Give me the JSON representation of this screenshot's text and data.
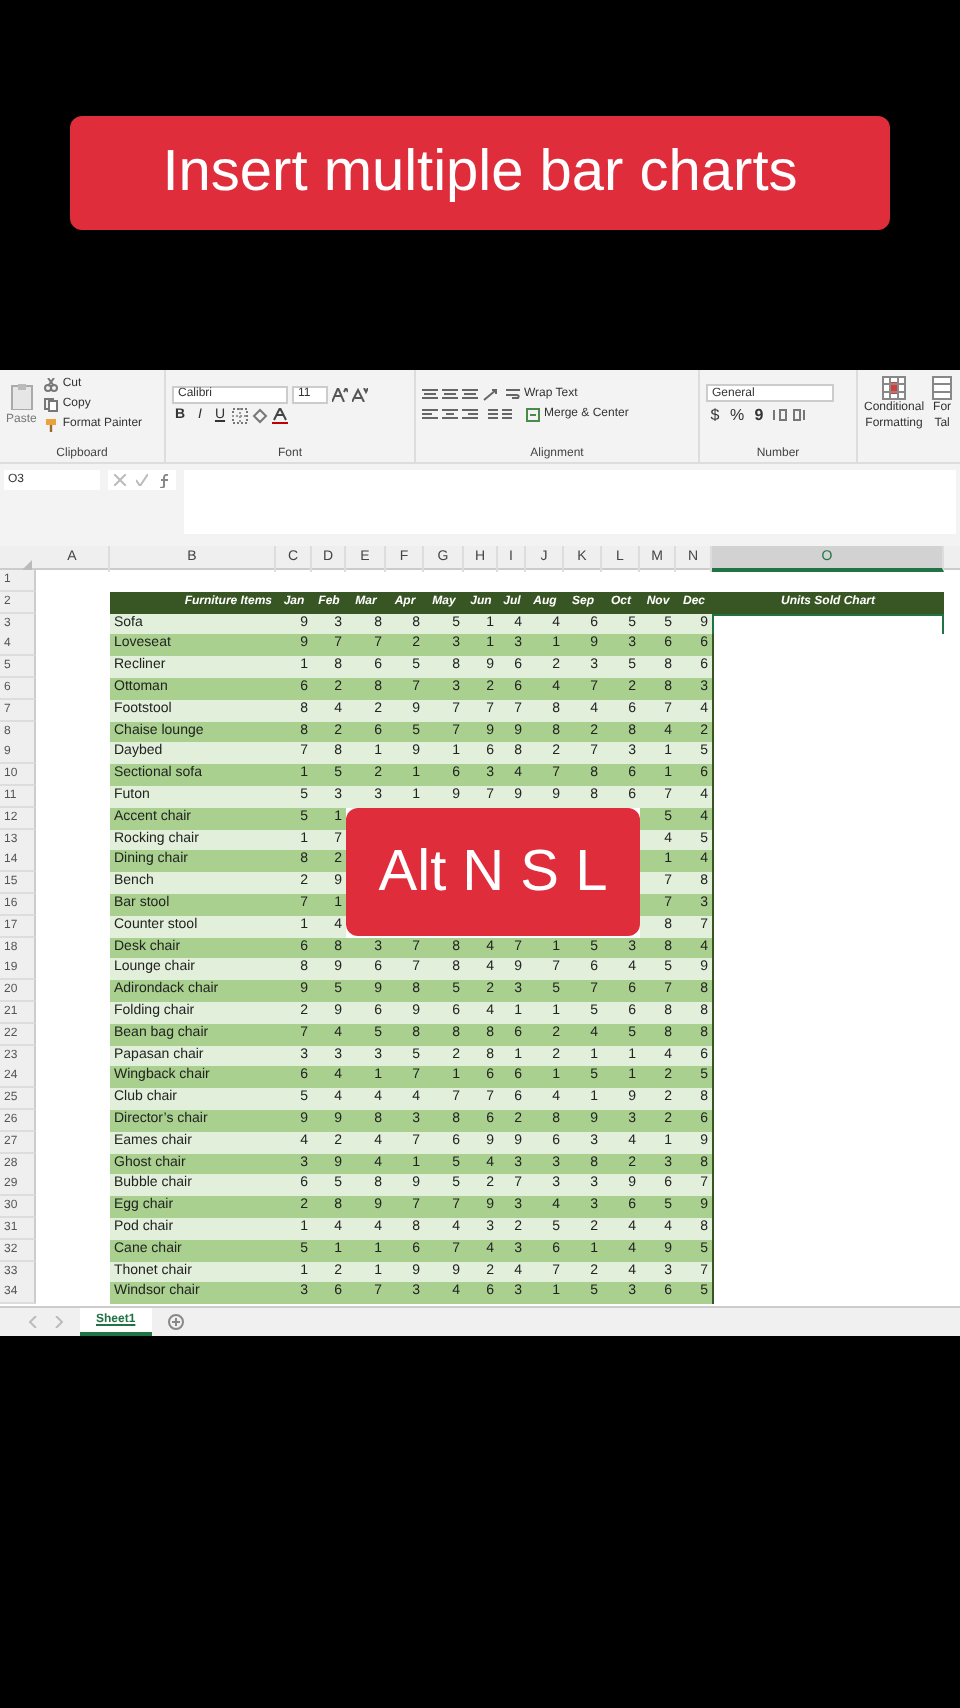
{
  "caption": "Insert multiple bar charts",
  "ribbon": {
    "groups": [
      {
        "kind": "clipboard",
        "label": "Clipboard",
        "paste": "Paste",
        "cut": "Cut",
        "copy": "Copy",
        "format_painter": "Format Painter"
      },
      {
        "kind": "font",
        "label": "Font",
        "font_name": "Calibri",
        "font_size": "11",
        "bold": "B",
        "italic": "I",
        "underline": "U"
      },
      {
        "kind": "alignment",
        "label": "Alignment",
        "wrap": "Wrap Text",
        "merge": "Merge & Center"
      },
      {
        "kind": "number",
        "label": "Number",
        "format": "General",
        "currency": "$",
        "percent": "%",
        "comma": "9"
      },
      {
        "kind": "styles",
        "conditional": [
          "Conditional",
          "Formatting"
        ],
        "format_table": [
          "For",
          "Tal"
        ]
      }
    ]
  },
  "formula_bar": {
    "name_box": "O3"
  },
  "sheet": {
    "columns": [
      {
        "label": "A",
        "selected": false
      },
      {
        "label": "B",
        "selected": false
      },
      {
        "label": "C",
        "selected": false
      },
      {
        "label": "D",
        "selected": false
      },
      {
        "label": "E",
        "selected": false
      },
      {
        "label": "F",
        "selected": false
      },
      {
        "label": "G",
        "selected": false
      },
      {
        "label": "H",
        "selected": false
      },
      {
        "label": "I",
        "selected": false
      },
      {
        "label": "J",
        "selected": false
      },
      {
        "label": "K",
        "selected": false
      },
      {
        "label": "L",
        "selected": false
      },
      {
        "label": "M",
        "selected": false
      },
      {
        "label": "N",
        "selected": false
      },
      {
        "label": "O",
        "selected": true
      }
    ],
    "blank_row": "1",
    "header_row": {
      "number": "2",
      "item": "Furniture Items",
      "months": [
        "Jan",
        "Feb",
        "Mar",
        "Apr",
        "May",
        "Jun",
        "Jul",
        "Aug",
        "Sep",
        "Oct",
        "Nov",
        "Dec"
      ],
      "chart": "Units Sold Chart"
    },
    "rows": [
      {
        "number": "3",
        "item": "Sofa",
        "values": [
          "9",
          "3",
          "8",
          "8",
          "5",
          "1",
          "4",
          "4",
          "6",
          "5",
          "5",
          "9"
        ],
        "chart_selected": true
      },
      {
        "number": "4",
        "item": "Loveseat",
        "values": [
          "9",
          "7",
          "7",
          "2",
          "3",
          "1",
          "3",
          "1",
          "9",
          "3",
          "6",
          "6"
        ],
        "chart_selected": false
      },
      {
        "number": "5",
        "item": "Recliner",
        "values": [
          "1",
          "8",
          "6",
          "5",
          "8",
          "9",
          "6",
          "2",
          "3",
          "5",
          "8",
          "6"
        ],
        "chart_selected": false
      },
      {
        "number": "6",
        "item": "Ottoman",
        "values": [
          "6",
          "2",
          "8",
          "7",
          "3",
          "2",
          "6",
          "4",
          "7",
          "2",
          "8",
          "3"
        ],
        "chart_selected": false
      },
      {
        "number": "7",
        "item": "Footstool",
        "values": [
          "8",
          "4",
          "2",
          "9",
          "7",
          "7",
          "7",
          "8",
          "4",
          "6",
          "7",
          "4"
        ],
        "chart_selected": false
      },
      {
        "number": "8",
        "item": "Chaise lounge",
        "values": [
          "8",
          "2",
          "6",
          "5",
          "7",
          "9",
          "9",
          "8",
          "2",
          "8",
          "4",
          "2"
        ],
        "chart_selected": false
      },
      {
        "number": "9",
        "item": "Daybed",
        "values": [
          "7",
          "8",
          "1",
          "9",
          "1",
          "6",
          "8",
          "2",
          "7",
          "3",
          "1",
          "5"
        ],
        "chart_selected": false
      },
      {
        "number": "10",
        "item": "Sectional sofa",
        "values": [
          "1",
          "5",
          "2",
          "1",
          "6",
          "3",
          "4",
          "7",
          "8",
          "6",
          "1",
          "6"
        ],
        "chart_selected": false
      },
      {
        "number": "11",
        "item": "Futon",
        "values": [
          "5",
          "3",
          "3",
          "1",
          "9",
          "7",
          "9",
          "9",
          "8",
          "6",
          "7",
          "4"
        ],
        "chart_selected": false
      },
      {
        "number": "12",
        "item": "Accent chair",
        "kind": "partial",
        "values": [
          "5",
          "1",
          "5",
          "4"
        ],
        "chart_selected": false
      },
      {
        "number": "13",
        "item": "Rocking chair",
        "kind": "partial",
        "values": [
          "1",
          "7",
          "4",
          "5"
        ],
        "chart_selected": false
      },
      {
        "number": "14",
        "item": "Dining chair",
        "kind": "partial",
        "values": [
          "8",
          "2",
          "1",
          "4"
        ],
        "chart_selected": false
      },
      {
        "number": "15",
        "item": "Bench",
        "kind": "partial",
        "values": [
          "2",
          "9",
          "7",
          "8"
        ],
        "chart_selected": false
      },
      {
        "number": "16",
        "item": "Bar stool",
        "kind": "partial",
        "values": [
          "7",
          "1",
          "7",
          "3"
        ],
        "chart_selected": false
      },
      {
        "number": "17",
        "item": "Counter stool",
        "kind": "partial",
        "values": [
          "1",
          "4",
          "8",
          "7"
        ],
        "chart_selected": false
      },
      {
        "number": "18",
        "item": "Desk chair",
        "values": [
          "6",
          "8",
          "3",
          "7",
          "8",
          "4",
          "7",
          "1",
          "5",
          "3",
          "8",
          "4"
        ],
        "chart_selected": false
      },
      {
        "number": "19",
        "item": "Lounge chair",
        "values": [
          "8",
          "9",
          "6",
          "7",
          "8",
          "4",
          "9",
          "7",
          "6",
          "4",
          "5",
          "9"
        ],
        "chart_selected": false
      },
      {
        "number": "20",
        "item": "Adirondack chair",
        "values": [
          "9",
          "5",
          "9",
          "8",
          "5",
          "2",
          "3",
          "5",
          "7",
          "6",
          "7",
          "8"
        ],
        "chart_selected": false
      },
      {
        "number": "21",
        "item": "Folding chair",
        "values": [
          "2",
          "9",
          "6",
          "9",
          "6",
          "4",
          "1",
          "1",
          "5",
          "6",
          "8",
          "8"
        ],
        "chart_selected": false
      },
      {
        "number": "22",
        "item": "Bean bag chair",
        "values": [
          "7",
          "4",
          "5",
          "8",
          "8",
          "8",
          "6",
          "2",
          "4",
          "5",
          "8",
          "8"
        ],
        "chart_selected": false
      },
      {
        "number": "23",
        "item": "Papasan chair",
        "values": [
          "3",
          "3",
          "3",
          "5",
          "2",
          "8",
          "1",
          "2",
          "1",
          "1",
          "4",
          "6"
        ],
        "chart_selected": false
      },
      {
        "number": "24",
        "item": "Wingback chair",
        "values": [
          "6",
          "4",
          "1",
          "7",
          "1",
          "6",
          "6",
          "1",
          "5",
          "1",
          "2",
          "5"
        ],
        "chart_selected": false
      },
      {
        "number": "25",
        "item": "Club chair",
        "values": [
          "5",
          "4",
          "4",
          "4",
          "7",
          "7",
          "6",
          "4",
          "1",
          "9",
          "2",
          "8"
        ],
        "chart_selected": false
      },
      {
        "number": "26",
        "item": "Director’s chair",
        "values": [
          "9",
          "9",
          "8",
          "3",
          "8",
          "6",
          "2",
          "8",
          "9",
          "3",
          "2",
          "6"
        ],
        "chart_selected": false
      },
      {
        "number": "27",
        "item": "Eames chair",
        "values": [
          "4",
          "2",
          "4",
          "7",
          "6",
          "9",
          "9",
          "6",
          "3",
          "4",
          "1",
          "9"
        ],
        "chart_selected": false
      },
      {
        "number": "28",
        "item": "Ghost chair",
        "values": [
          "3",
          "9",
          "4",
          "1",
          "5",
          "4",
          "3",
          "3",
          "8",
          "2",
          "3",
          "8"
        ],
        "chart_selected": false
      },
      {
        "number": "29",
        "item": "Bubble chair",
        "values": [
          "6",
          "5",
          "8",
          "9",
          "5",
          "2",
          "7",
          "3",
          "3",
          "9",
          "6",
          "7"
        ],
        "chart_selected": false
      },
      {
        "number": "30",
        "item": "Egg chair",
        "values": [
          "2",
          "8",
          "9",
          "7",
          "7",
          "9",
          "3",
          "4",
          "3",
          "6",
          "5",
          "9"
        ],
        "chart_selected": false
      },
      {
        "number": "31",
        "item": "Pod chair",
        "values": [
          "1",
          "4",
          "4",
          "8",
          "4",
          "3",
          "2",
          "5",
          "2",
          "4",
          "4",
          "8"
        ],
        "chart_selected": false
      },
      {
        "number": "32",
        "item": "Cane chair",
        "values": [
          "5",
          "1",
          "1",
          "6",
          "7",
          "4",
          "3",
          "6",
          "1",
          "4",
          "9",
          "5"
        ],
        "chart_selected": false
      },
      {
        "number": "33",
        "item": "Thonet chair",
        "values": [
          "1",
          "2",
          "1",
          "9",
          "9",
          "2",
          "4",
          "7",
          "2",
          "4",
          "3",
          "7"
        ],
        "chart_selected": false
      },
      {
        "number": "34",
        "item": "Windsor chair",
        "values": [
          "3",
          "6",
          "7",
          "3",
          "4",
          "6",
          "3",
          "1",
          "5",
          "3",
          "6",
          "5"
        ],
        "chart_selected": false
      }
    ]
  },
  "overlay_caption": "Alt N S L",
  "sheet_tabs": [
    {
      "label": "Sheet1",
      "selected": true
    }
  ]
}
